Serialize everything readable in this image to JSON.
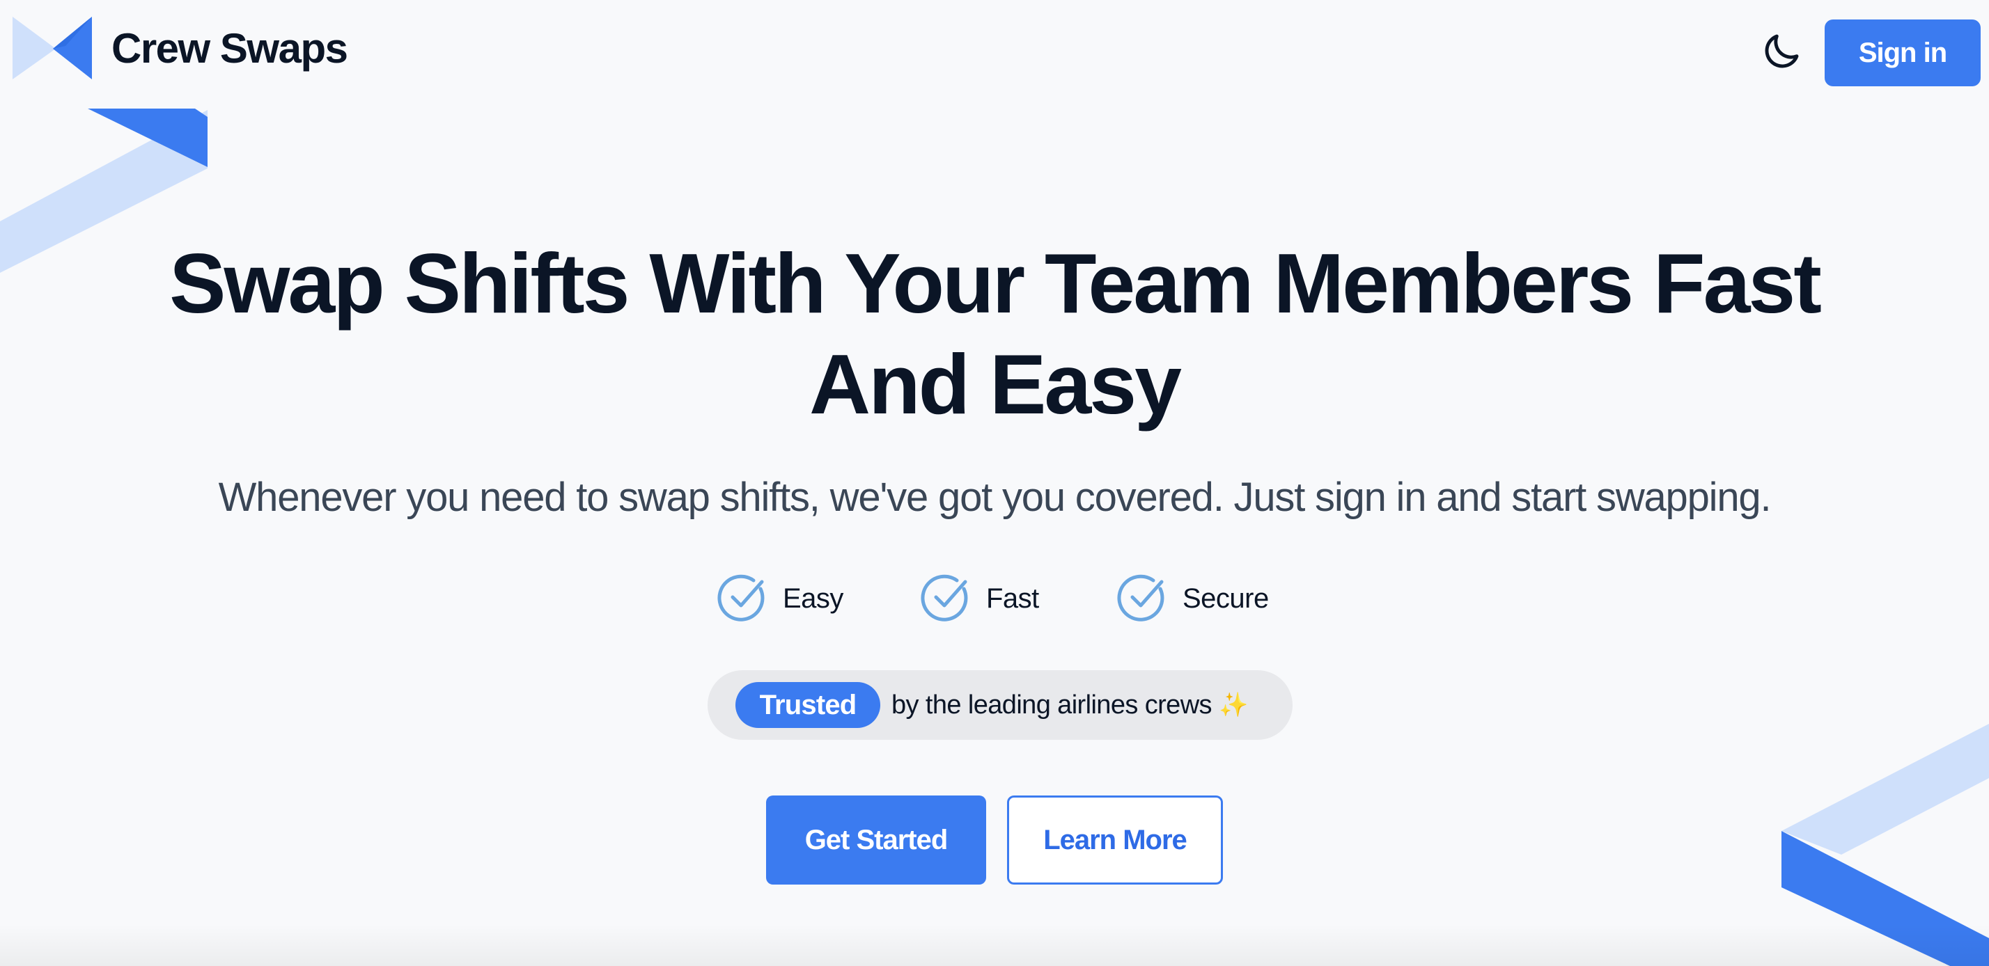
{
  "brand": {
    "name": "Crew Swaps",
    "logo_icon": "crew-swaps-logo"
  },
  "header": {
    "theme_toggle_icon": "moon-icon",
    "signin_label": "Sign in"
  },
  "hero": {
    "title_line1": "Swap Shifts With Your Team Members Fast",
    "title_line2": "And Easy",
    "subtitle": "Whenever you need to swap shifts, we've got you covered. Just sign in and start swapping."
  },
  "features": [
    {
      "label": "Easy",
      "icon": "check-circle-icon"
    },
    {
      "label": "Fast",
      "icon": "check-circle-icon"
    },
    {
      "label": "Secure",
      "icon": "check-circle-icon"
    }
  ],
  "trusted": {
    "badge": "Trusted",
    "text": "by the leading airlines crews",
    "emoji": "✨"
  },
  "cta": {
    "primary_label": "Get Started",
    "secondary_label": "Learn More"
  },
  "colors": {
    "accent": "#3b7bf0",
    "accent_light": "#cfe0fb",
    "text_dark": "#0b1526",
    "text_muted": "#3a4656",
    "check": "#6aa6e0",
    "pill_bg": "#e8e9ec",
    "background": "#f8f9fb"
  }
}
